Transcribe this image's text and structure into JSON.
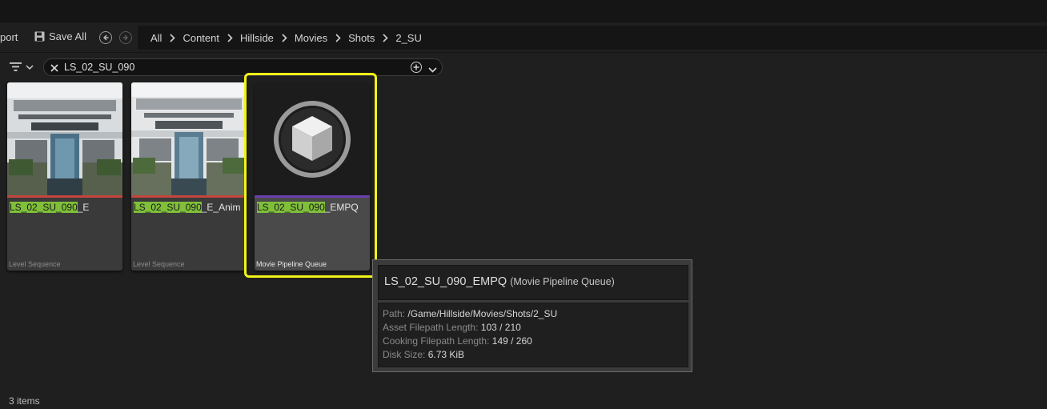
{
  "toolbar": {
    "import_label": "port",
    "save_all_label": "Save All",
    "save_icon": "floppy-disk-icon",
    "back_icon": "arrow-left-circle-icon",
    "forward_icon": "arrow-right-circle-icon"
  },
  "breadcrumb": [
    "All",
    "Content",
    "Hillside",
    "Movies",
    "Shots",
    "2_SU"
  ],
  "search": {
    "value": "LS_02_SU_090",
    "filter_icon": "filter-icon",
    "clear_icon": "close-icon",
    "add_icon": "plus-circle-icon"
  },
  "assets": [
    {
      "name_match": "LS_02_SU_090",
      "name_rest": "_E",
      "type": "Level Sequence",
      "type_color": "#c4453c",
      "thumbnail": "building-render"
    },
    {
      "name_match": "LS_02_SU_090",
      "name_rest": "_E_Anim",
      "type": "Level Sequence",
      "type_color": "#c4453c",
      "thumbnail": "building-render"
    },
    {
      "name_match": "LS_02_SU_090",
      "name_rest": "_EMPQ",
      "type": "Movie Pipeline Queue",
      "type_color": "#6a3fb0",
      "thumbnail": "cube-icon",
      "selected": true
    }
  ],
  "tooltip": {
    "title": "LS_02_SU_090_EMPQ",
    "class_name": "(Movie Pipeline Queue)",
    "rows": [
      {
        "key": "Path:",
        "value": "/Game/Hillside/Movies/Shots/2_SU"
      },
      {
        "key": "Asset Filepath Length:",
        "value": "103 / 210"
      },
      {
        "key": "Cooking Filepath Length:",
        "value": "149 / 260"
      },
      {
        "key": "Disk Size:",
        "value": "6.73 KiB"
      }
    ]
  },
  "status": {
    "item_count": "3 items"
  },
  "colors": {
    "highlight": "#7fbf3a",
    "selection": "#f2f219",
    "level_sequence": "#c4453c",
    "movie_pipeline_queue": "#6a3fb0"
  }
}
